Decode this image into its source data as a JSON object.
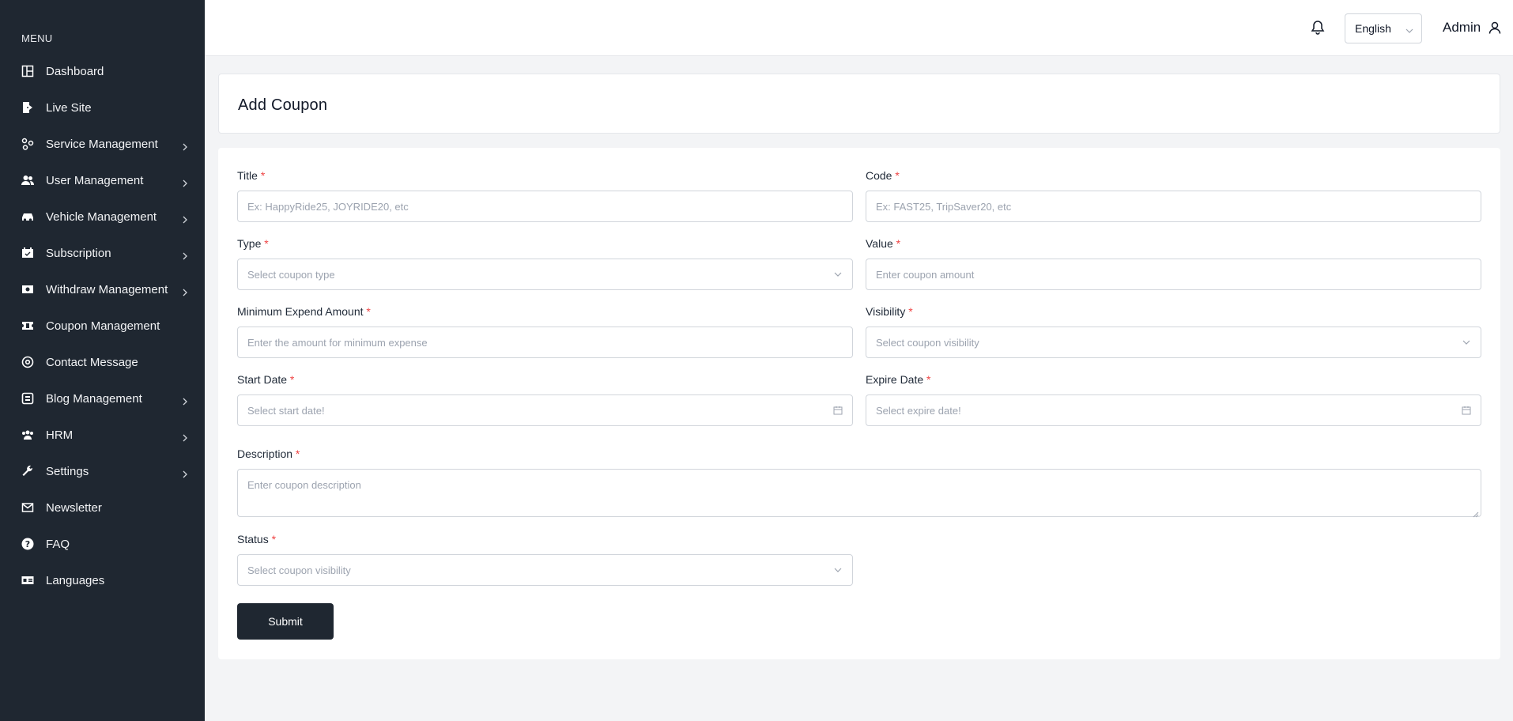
{
  "sidebar": {
    "heading": "MENU",
    "items": [
      {
        "label": "Dashboard",
        "icon": "dashboard-icon",
        "has_children": false
      },
      {
        "label": "Live Site",
        "icon": "external-door-icon",
        "has_children": false
      },
      {
        "label": "Service Management",
        "icon": "services-icon",
        "has_children": true
      },
      {
        "label": "User Management",
        "icon": "users-icon",
        "has_children": true
      },
      {
        "label": "Vehicle Management",
        "icon": "car-icon",
        "has_children": true
      },
      {
        "label": "Subscription",
        "icon": "calendar-icon",
        "has_children": true
      },
      {
        "label": "Withdraw Management",
        "icon": "money-icon",
        "has_children": true
      },
      {
        "label": "Coupon Management",
        "icon": "ticket-icon",
        "has_children": false
      },
      {
        "label": "Contact Message",
        "icon": "at-icon",
        "has_children": false
      },
      {
        "label": "Blog Management",
        "icon": "blog-icon",
        "has_children": true
      },
      {
        "label": "HRM",
        "icon": "team-icon",
        "has_children": true
      },
      {
        "label": "Settings",
        "icon": "wrench-icon",
        "has_children": true
      },
      {
        "label": "Newsletter",
        "icon": "mail-icon",
        "has_children": false
      },
      {
        "label": "FAQ",
        "icon": "question-icon",
        "has_children": false
      },
      {
        "label": "Languages",
        "icon": "language-icon",
        "has_children": false
      }
    ]
  },
  "topbar": {
    "language": "English",
    "user_name": "Admin"
  },
  "page": {
    "title": "Add Coupon"
  },
  "form": {
    "title_label": "Title",
    "title_placeholder": "Ex: HappyRide25, JOYRIDE20, etc",
    "code_label": "Code",
    "code_placeholder": "Ex: FAST25, TripSaver20, etc",
    "type_label": "Type",
    "type_placeholder": "Select coupon type",
    "value_label": "Value",
    "value_placeholder": "Enter coupon amount",
    "min_label": "Minimum Expend Amount",
    "min_placeholder": "Enter the amount for minimum expense",
    "visibility_label": "Visibility",
    "visibility_placeholder": "Select coupon visibility",
    "start_label": "Start Date",
    "start_placeholder": "Select start date!",
    "expire_label": "Expire Date",
    "expire_placeholder": "Select expire date!",
    "description_label": "Description",
    "description_placeholder": "Enter coupon description",
    "status_label": "Status",
    "status_placeholder": "Select coupon visibility",
    "required_mark": "*",
    "submit_label": "Submit"
  },
  "colors": {
    "sidebar_bg": "#1f2731",
    "page_bg": "#f3f4f6",
    "required": "#ef4444",
    "button_bg": "#1f2731"
  }
}
